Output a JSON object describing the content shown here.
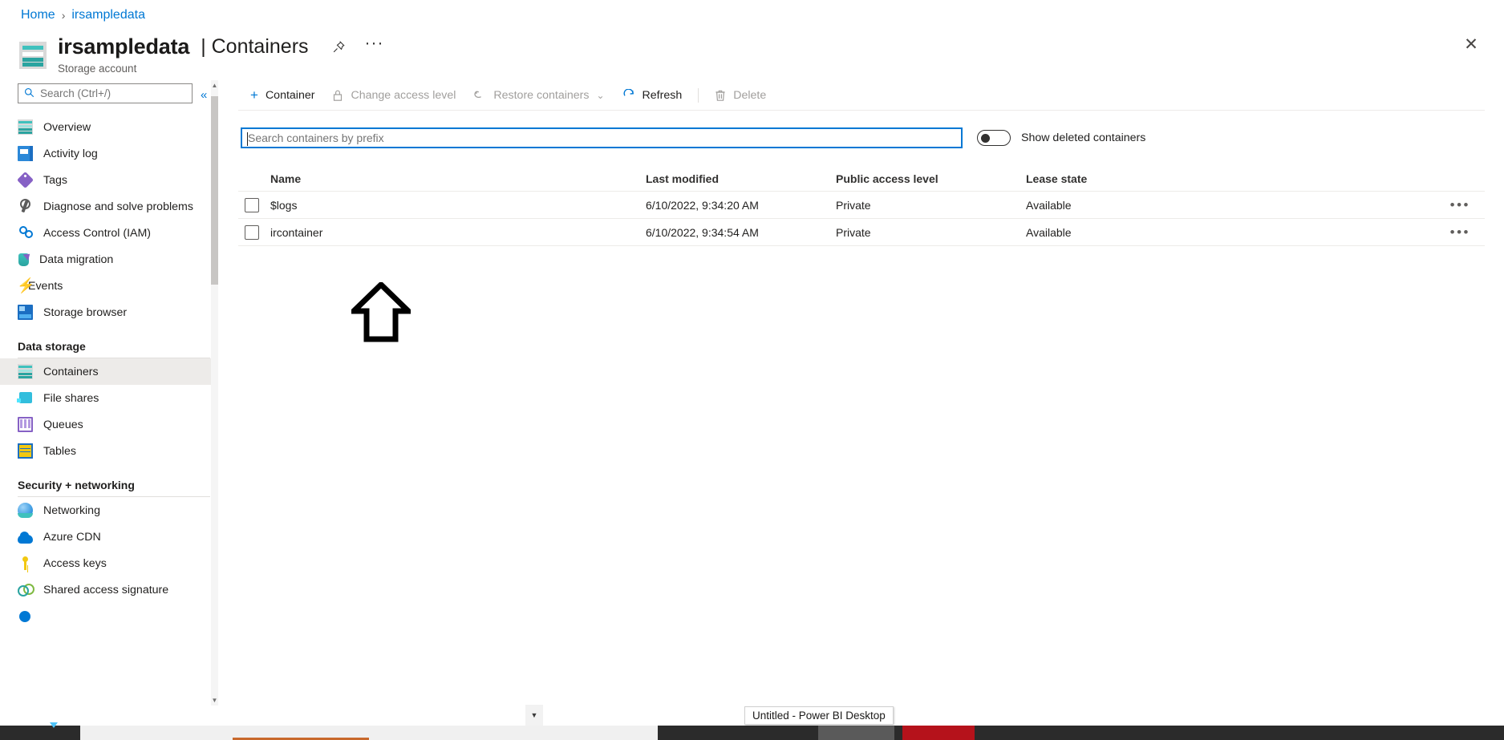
{
  "breadcrumb": {
    "home": "Home",
    "separator": "›",
    "current": "irsampledata"
  },
  "header": {
    "resource_name": "irsampledata",
    "section_title": "| Containers",
    "resource_type": "Storage account",
    "pin_icon": "pin-icon",
    "more_icon": "ellipsis-icon",
    "close_icon": "close-icon",
    "accent_color": "#0078d4"
  },
  "sidebar": {
    "search_placeholder": "Search (Ctrl+/)",
    "search_value": "",
    "search_icon": "search-icon",
    "collapse_icon": "chevron-double-left-icon",
    "items": [
      {
        "label": "Overview",
        "icon": "overview-icon",
        "selected": false
      },
      {
        "label": "Activity log",
        "icon": "activity-log-icon",
        "selected": false
      },
      {
        "label": "Tags",
        "icon": "tag-icon",
        "selected": false
      },
      {
        "label": "Diagnose and solve problems",
        "icon": "wrench-icon",
        "selected": false
      },
      {
        "label": "Access Control (IAM)",
        "icon": "users-icon",
        "selected": false
      },
      {
        "label": "Data migration",
        "icon": "data-migration-icon",
        "selected": false
      },
      {
        "label": "Events",
        "icon": "lightning-bolt-icon",
        "selected": false
      },
      {
        "label": "Storage browser",
        "icon": "storage-browser-icon",
        "selected": false
      }
    ],
    "groups": [
      {
        "title": "Data storage",
        "items": [
          {
            "label": "Containers",
            "icon": "containers-icon",
            "selected": true
          },
          {
            "label": "File shares",
            "icon": "file-share-icon",
            "selected": false
          },
          {
            "label": "Queues",
            "icon": "queue-icon",
            "selected": false
          },
          {
            "label": "Tables",
            "icon": "table-icon",
            "selected": false
          }
        ]
      },
      {
        "title": "Security + networking",
        "items": [
          {
            "label": "Networking",
            "icon": "networking-icon",
            "selected": false
          },
          {
            "label": "Azure CDN",
            "icon": "cloud-icon",
            "selected": false
          },
          {
            "label": "Access keys",
            "icon": "key-icon",
            "selected": false
          },
          {
            "label": "Shared access signature",
            "icon": "links-icon",
            "selected": false
          }
        ]
      }
    ]
  },
  "toolbar": {
    "add_container": "Container",
    "add_container_icon": "plus-icon",
    "change_access_level": "Change access level",
    "change_access_level_icon": "lock-icon",
    "restore_containers": "Restore containers",
    "restore_containers_icon": "undo-icon",
    "restore_chevron_icon": "chevron-down-icon",
    "refresh": "Refresh",
    "refresh_icon": "refresh-icon",
    "delete": "Delete",
    "delete_icon": "trash-icon"
  },
  "filters": {
    "prefix_search_placeholder": "Search containers by prefix",
    "prefix_search_value": "",
    "show_deleted_label": "Show deleted containers",
    "show_deleted_on": false
  },
  "table": {
    "columns": [
      "Name",
      "Last modified",
      "Public access level",
      "Lease state"
    ],
    "row_menu_icon": "ellipsis-icon",
    "rows": [
      {
        "name": "$logs",
        "last_modified": "6/10/2022, 9:34:20 AM",
        "public_access_level": "Private",
        "lease_state": "Available"
      },
      {
        "name": "ircontainer",
        "last_modified": "6/10/2022, 9:34:54 AM",
        "public_access_level": "Private",
        "lease_state": "Available"
      }
    ]
  },
  "annotation": {
    "arrow_icon": "up-arrow-annotation"
  },
  "taskbar": {
    "tooltip": "Untitled - Power BI Desktop",
    "overflow_icon": "caret-up-icon"
  }
}
